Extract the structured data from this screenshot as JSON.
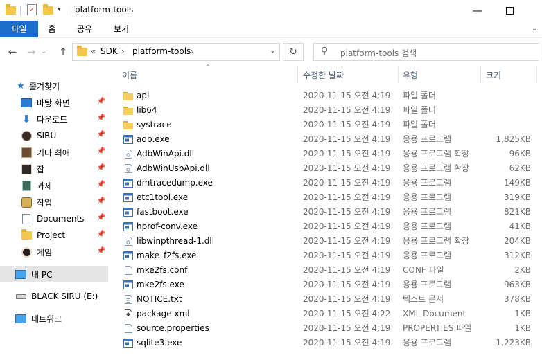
{
  "window": {
    "title": "platform-tools",
    "controls": {
      "minimize_icon": "minimize-icon",
      "maximize_icon": "maximize-icon"
    }
  },
  "ribbon": {
    "tabs": [
      {
        "label": "파일",
        "active": true
      },
      {
        "label": "홈"
      },
      {
        "label": "공유"
      },
      {
        "label": "보기"
      }
    ]
  },
  "address": {
    "overflow": "«",
    "crumbs": [
      "SDK",
      "platform-tools"
    ]
  },
  "search": {
    "placeholder": "platform-tools 검색"
  },
  "nav": {
    "quick_access": "즐겨찾기",
    "items": [
      {
        "label": "바탕 화면",
        "icon": "desktop-icon",
        "pinned": true
      },
      {
        "label": "다운로드",
        "icon": "download-icon",
        "pinned": true
      },
      {
        "label": "SIRU",
        "icon": "avatar-icon",
        "pinned": true
      },
      {
        "label": "기타 최애",
        "icon": "avatar-icon",
        "pinned": true
      },
      {
        "label": "잡",
        "icon": "avatar-icon",
        "pinned": true
      },
      {
        "label": "과제",
        "icon": "avatar-icon",
        "pinned": true
      },
      {
        "label": "작업",
        "icon": "avatar-icon",
        "pinned": true
      },
      {
        "label": "Documents",
        "icon": "document-icon",
        "pinned": true
      },
      {
        "label": "Project",
        "icon": "folder-icon",
        "pinned": true
      },
      {
        "label": "게임",
        "icon": "avatar-icon",
        "pinned": true
      }
    ],
    "this_pc": "내 PC",
    "drive": "BLACK SIRU (E:)",
    "network": "네트워크"
  },
  "columns": {
    "name": "이름",
    "date": "수정한 날짜",
    "type": "유형",
    "size": "크기"
  },
  "files": [
    {
      "name": "api",
      "date": "2020-11-15 오전 4:19",
      "type": "파일 폴더",
      "size": "",
      "icon": "folder"
    },
    {
      "name": "lib64",
      "date": "2020-11-15 오전 4:19",
      "type": "파일 폴더",
      "size": "",
      "icon": "folder"
    },
    {
      "name": "systrace",
      "date": "2020-11-15 오전 4:19",
      "type": "파일 폴더",
      "size": "",
      "icon": "folder"
    },
    {
      "name": "adb.exe",
      "date": "2020-11-15 오전 4:19",
      "type": "응용 프로그램",
      "size": "1,825KB",
      "icon": "exe"
    },
    {
      "name": "AdbWinApi.dll",
      "date": "2020-11-15 오전 4:19",
      "type": "응용 프로그램 확장",
      "size": "96KB",
      "icon": "dll"
    },
    {
      "name": "AdbWinUsbApi.dll",
      "date": "2020-11-15 오전 4:19",
      "type": "응용 프로그램 확장",
      "size": "62KB",
      "icon": "dll"
    },
    {
      "name": "dmtracedump.exe",
      "date": "2020-11-15 오전 4:19",
      "type": "응용 프로그램",
      "size": "149KB",
      "icon": "exe"
    },
    {
      "name": "etc1tool.exe",
      "date": "2020-11-15 오전 4:19",
      "type": "응용 프로그램",
      "size": "319KB",
      "icon": "exe"
    },
    {
      "name": "fastboot.exe",
      "date": "2020-11-15 오전 4:19",
      "type": "응용 프로그램",
      "size": "821KB",
      "icon": "exe"
    },
    {
      "name": "hprof-conv.exe",
      "date": "2020-11-15 오전 4:19",
      "type": "응용 프로그램",
      "size": "41KB",
      "icon": "exe"
    },
    {
      "name": "libwinpthread-1.dll",
      "date": "2020-11-15 오전 4:19",
      "type": "응용 프로그램 확장",
      "size": "204KB",
      "icon": "dll"
    },
    {
      "name": "make_f2fs.exe",
      "date": "2020-11-15 오전 4:19",
      "type": "응용 프로그램",
      "size": "312KB",
      "icon": "exe"
    },
    {
      "name": "mke2fs.conf",
      "date": "2020-11-15 오전 4:19",
      "type": "CONF 파일",
      "size": "2KB",
      "icon": "file"
    },
    {
      "name": "mke2fs.exe",
      "date": "2020-11-15 오전 4:19",
      "type": "응용 프로그램",
      "size": "963KB",
      "icon": "exe"
    },
    {
      "name": "NOTICE.txt",
      "date": "2020-11-15 오전 4:19",
      "type": "텍스트 문서",
      "size": "378KB",
      "icon": "txt"
    },
    {
      "name": "package.xml",
      "date": "2020-11-15 오전 4:22",
      "type": "XML Document",
      "size": "1KB",
      "icon": "xml"
    },
    {
      "name": "source.properties",
      "date": "2020-11-15 오전 4:19",
      "type": "PROPERTIES 파일",
      "size": "1KB",
      "icon": "file"
    },
    {
      "name": "sqlite3.exe",
      "date": "2020-11-15 오전 4:19",
      "type": "응용 프로그램",
      "size": "1,223KB",
      "icon": "exe"
    }
  ],
  "colors": {
    "accent": "#1a6dc8",
    "folder": "#f3c74e",
    "header_text": "#4c607a"
  }
}
